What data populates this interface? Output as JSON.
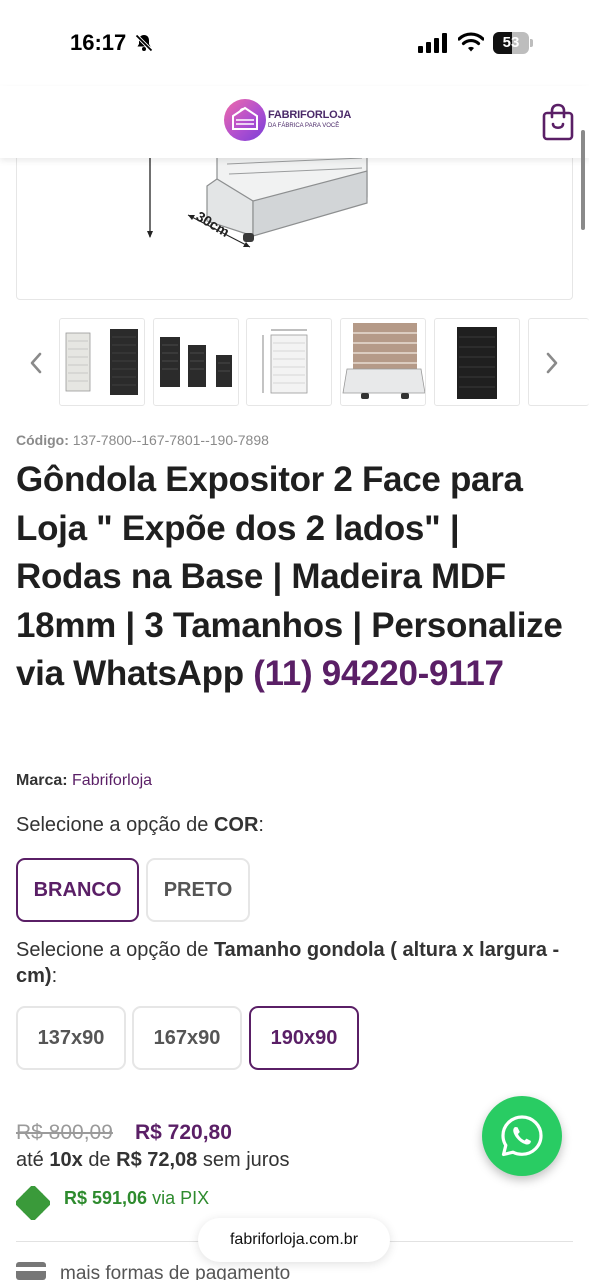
{
  "status_bar": {
    "time": "16:17",
    "battery": "53",
    "battery_level": 0.53,
    "icons": [
      "bell-slash-icon",
      "cellular-signal-icon",
      "wifi-icon",
      "battery-icon"
    ]
  },
  "header": {
    "logo_title": "FABRIFORLOJA",
    "logo_subtitle": "DA FÁBRICA PARA VOCÊ",
    "cart_icon": "shopping-bag-icon"
  },
  "gallery": {
    "dimension_label": "30cm",
    "prev_icon": "chevron-left-icon",
    "next_icon": "chevron-right-icon",
    "thumbnails": [
      {
        "label": "white and black gondola"
      },
      {
        "label": "three sizes black gondolas"
      },
      {
        "label": "dimension drawing"
      },
      {
        "label": "white gondola base"
      },
      {
        "label": "black gondola"
      }
    ]
  },
  "product": {
    "code_label": "Código:",
    "code_value": "137-7800--167-7801--190-7898",
    "title": "Gôndola Expositor 2 Face para Loja \" Expõe dos 2 lados\" | Rodas na Base | Madeira MDF 18mm | 3 Tamanhos | Personalize via WhatsApp",
    "title_phone": "(11) 94220-9117",
    "brand_label": "Marca:",
    "brand_value": "Fabriforloja"
  },
  "color_option": {
    "prefix": "Selecione a opção de",
    "name": "COR",
    "suffix": ":",
    "options": [
      "BRANCO",
      "PRETO"
    ],
    "selected": "BRANCO"
  },
  "size_option": {
    "prefix": "Selecione a opção de",
    "name": "Tamanho gondola ( altura x largura - cm)",
    "suffix": ":",
    "options": [
      "137x90",
      "167x90",
      "190x90"
    ],
    "selected": "190x90"
  },
  "pricing": {
    "old_price": "R$ 800,09",
    "new_price": "R$ 720,80",
    "installments_prefix": "até",
    "installments_count": "10x",
    "installments_mid": "de",
    "installments_value": "R$ 72,08",
    "installments_suffix": "sem juros",
    "pix_price": "R$ 591,06",
    "pix_label": "via PIX",
    "more_payment": "mais formas de pagamento"
  },
  "browser": {
    "url": "fabriforloja.com.br"
  },
  "colors": {
    "brand_purple": "#5a1f66",
    "whatsapp_green": "#29cc63",
    "pix_green": "#2e8b2e"
  }
}
